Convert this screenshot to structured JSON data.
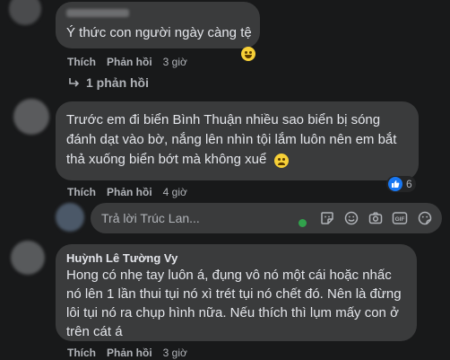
{
  "comments": [
    {
      "text": "Ý thức con người ngày càng tệ",
      "like": "Thích",
      "reply": "Phản hồi",
      "time": "3 giờ"
    },
    {
      "text_lines": [
        "Trước em đi biển Bình Thuận nhiều sao biển bị sóng",
        "đánh dạt vào bờ, nắng lên nhìn tội lắm luôn nên em bắt",
        "thả xuống biển bớt mà không xuể"
      ],
      "like": "Thích",
      "reply": "Phản hồi",
      "time": "4 giờ",
      "reaction_count": "6"
    },
    {
      "author": "Huỳnh Lê Tường Vy",
      "text_lines": [
        "Hong có nhẹ tay luôn á, đụng vô nó một cái hoặc nhấc",
        "nó lên 1 lần thui tụi nó xì trét tụi nó chết đó. Nên là đừng",
        "lôi tụi nó ra chụp hình nữa. Nếu thích thì lụm mấy con ở",
        "trên cát á"
      ],
      "like": "Thích",
      "reply": "Phản hồi",
      "time": "3 giờ"
    }
  ],
  "replies_link": "1 phản hồi",
  "reply_box": {
    "placeholder": "Trả lời Trúc Lan..."
  },
  "icons": [
    "reply-arrow-icon",
    "like-reaction-icon",
    "sticker-icon",
    "emoji-icon",
    "camera-icon",
    "gif-icon",
    "sticker-alt-icon"
  ],
  "colors": {
    "background": "#18191a",
    "bubble": "#3a3b3c",
    "like_blue": "#1877f2",
    "online_green": "#31a24c"
  }
}
